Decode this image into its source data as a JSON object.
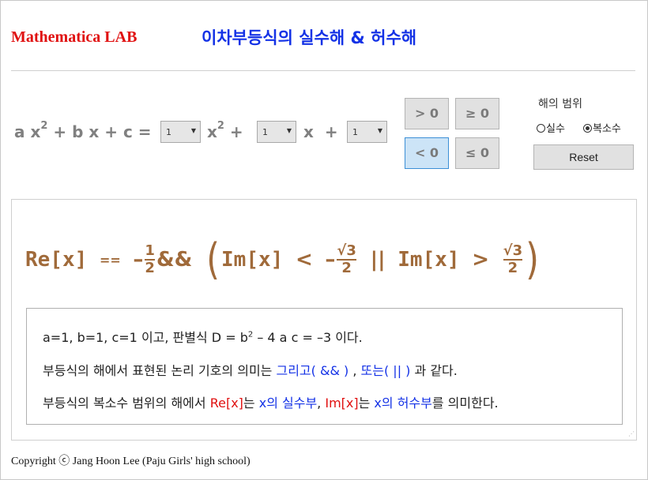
{
  "header": {
    "brand": "Mathematica LAB",
    "title": "이차부등식의 실수해 & 허수해"
  },
  "equation": {
    "lhs_a": "a x",
    "lhs_rest": "+ b x + c =",
    "sq": "2",
    "x2": "x",
    "plus1": "+",
    "x": "x",
    "plus2": "+"
  },
  "selects": {
    "a": "1",
    "b": "1",
    "c": "1"
  },
  "inequality_buttons": {
    "gt": "> 0",
    "ge": "≥ 0",
    "lt": "< 0",
    "le": "≤ 0",
    "selected": "lt"
  },
  "range": {
    "label": "해의 범위",
    "real": "실수",
    "complex": "복소수",
    "selected": "complex"
  },
  "reset_label": "Reset",
  "result": {
    "re": "Re[x]",
    "eq": "==",
    "neg": "–",
    "half_num": "1",
    "half_den": "2",
    "and": "&&",
    "im1": "Im[x]",
    "lt": "<",
    "neg2": "–",
    "sqrt": "√3",
    "den": "2",
    "or": "||",
    "im2": "Im[x]",
    "gt": ">",
    "sqrt2": "√3",
    "den2": "2"
  },
  "explanation": {
    "line1_a": "a=1, b=1, c=1 이고, 판별식 D = b",
    "line1_sq": "2",
    "line1_b": " – 4 a c = –3 이다.",
    "line2_a": "부등식의 해에서 표현된 논리 기호의 의미는 ",
    "line2_and": "그리고( && )",
    "line2_comma": " , ",
    "line2_or": "또는( || )",
    "line2_end": " 과 같다.",
    "line3_a": "부등식의 복소수 범위의 해에서 ",
    "line3_re": "Re[x]",
    "line3_is1": "는 ",
    "line3_real": "x의 실수부",
    "line3_comma": ", ",
    "line3_im": "Im[x]",
    "line3_is2": "는 ",
    "line3_imag": "x의 허수부",
    "line3_end": "를 의미한다."
  },
  "footer": {
    "copyright": "Copyright ⓒ Jang Hoon Lee (Paju Girls' high school)"
  },
  "colors": {
    "brand": "#e01010",
    "title": "#1432e6",
    "formula": "#a06a3a",
    "selected_button": "#cce4f7"
  }
}
